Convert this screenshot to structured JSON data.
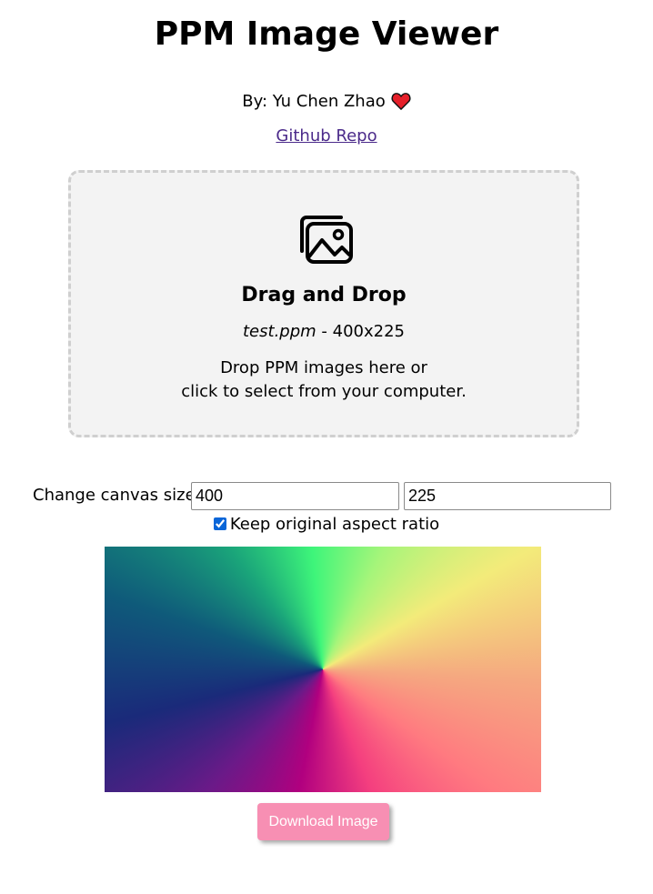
{
  "header": {
    "title": "PPM Image Viewer",
    "byline": "By: Yu Chen Zhao",
    "repo_link": "Github Repo"
  },
  "dropzone": {
    "title": "Drag and Drop",
    "filename": "test.ppm",
    "file_dims": " - 400x225",
    "line1": "Drop PPM images here or",
    "line2": "click to select from your computer.",
    "icon": "images-icon"
  },
  "canvas_size": {
    "label": "Change canvas size:",
    "width_value": "400",
    "height_value": "225",
    "keep_ratio_label": "Keep original aspect ratio",
    "keep_ratio_checked": true
  },
  "preview": {
    "gradient_colors": [
      "#f3eb7a",
      "#f5a880",
      "#ff7a80",
      "#f43f7f",
      "#b1007f",
      "#6a1a88",
      "#1a2a7a",
      "#0f5a7a",
      "#1aa47a",
      "#3ef57a",
      "#a6f57a"
    ]
  },
  "actions": {
    "download_label": "Download Image"
  },
  "colors": {
    "link": "#4b2a8a",
    "download_bg": "#f78fb3",
    "dropzone_bg": "#f3f3f3",
    "heart": "#e5202a"
  }
}
